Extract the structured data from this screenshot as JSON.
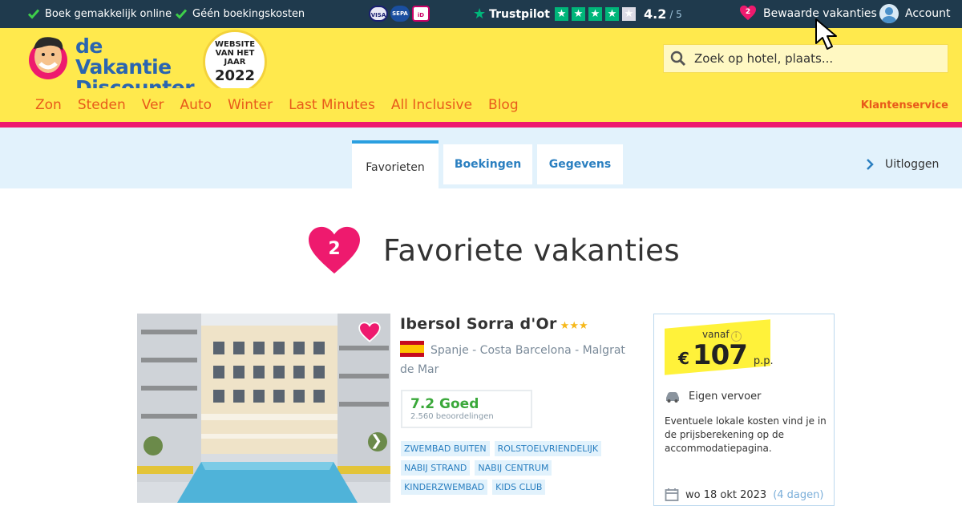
{
  "topbar": {
    "usp": [
      "Boek gemakkelijk online",
      "Géén boekingskosten"
    ],
    "payment_icons": [
      "Visa/Mastercard",
      "SEPA",
      "iDEAL"
    ],
    "trustpilot": {
      "label": "Trustpilot",
      "score": "4.2",
      "of": "/ 5",
      "stars_filled": 4
    },
    "favorites": {
      "count": "2",
      "label": "Bewaarde vakanties"
    },
    "account_label": "Account"
  },
  "header": {
    "logo_line1": "de Vakantie",
    "logo_line2": "Discounter",
    "badge_line1": "WEBSITE VAN HET JAAR",
    "badge_year": "2022",
    "search_placeholder": "Zoek op hotel, plaats..."
  },
  "nav": {
    "items": [
      "Zon",
      "Steden",
      "Ver",
      "Auto",
      "Winter",
      "Last Minutes",
      "All Inclusive",
      "Blog"
    ],
    "service": "Klantenservice"
  },
  "tabs": {
    "items": [
      "Favorieten",
      "Boekingen",
      "Gegevens"
    ],
    "logout": "Uitloggen"
  },
  "page": {
    "fav_count": "2",
    "title": "Favoriete vakanties"
  },
  "hotel": {
    "name": "Ibersol Sorra d'Or",
    "stars": 3,
    "location": "Spanje - Costa Barcelona - Malgrat de Mar",
    "rating": "7.2 Goed",
    "reviews": "2.560 beoordelingen",
    "tags": [
      "ZWEMBAD BUITEN",
      "ROLSTOELVRIENDELIJK",
      "NABIJ STRAND",
      "NABIJ CENTRUM",
      "KINDERZWEMBAD",
      "KIDS CLUB"
    ]
  },
  "price": {
    "vanaf": "vanaf",
    "currency": "€",
    "amount": "107",
    "per": "p.p.",
    "transport": "Eigen vervoer",
    "note": "Eventuele lokale kosten vind je in de prijsberekening op de accommodatiepagina.",
    "date": "wo 18 okt 2023",
    "days": "(4 dagen)"
  },
  "colors": {
    "topbar": "#1f3a4d",
    "yellow": "#ffe94d",
    "nav_link": "#e85a1a",
    "pink": "#ee1a6e",
    "tab_bg": "#e2f2fc",
    "link_blue": "#2a7fc0",
    "rating_green": "#3aa83a"
  }
}
